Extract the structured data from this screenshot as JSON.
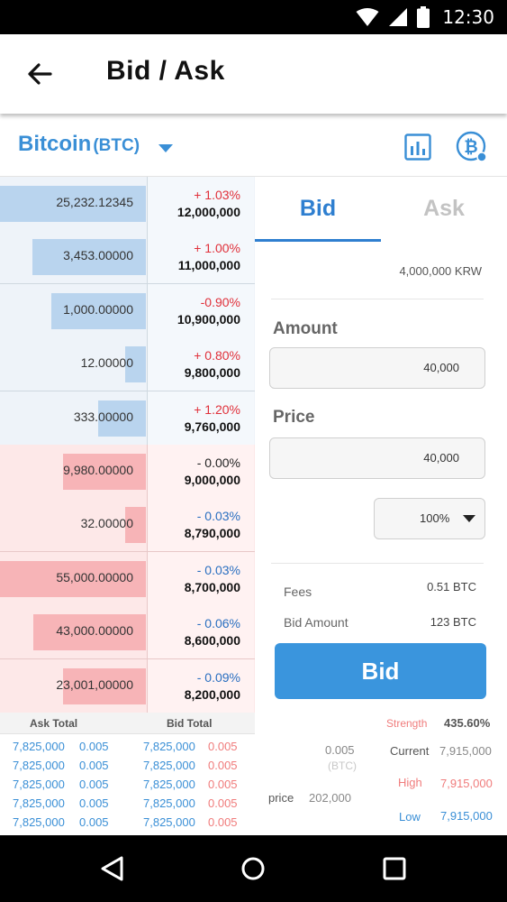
{
  "status_bar": {
    "time": "12:30"
  },
  "header": {
    "title": "Bid / Ask",
    "back_icon": "arrow-left-icon"
  },
  "coin": {
    "name": "Bitcoin",
    "code": "(BTC)"
  },
  "orderbook": {
    "ask_rows": [
      {
        "quantity": "25,232.12345",
        "change": "+ 1.03%",
        "price": "12,000,000",
        "direction": "up",
        "depth": 1.0
      },
      {
        "quantity": "3,453.00000",
        "change": "+ 1.00%",
        "price": "11,000,000",
        "direction": "up",
        "depth": 0.78
      },
      {
        "quantity": "1,000.00000",
        "change": "-0.90%",
        "price": "10,900,000",
        "direction": "up",
        "depth": 0.65
      },
      {
        "quantity": "12.00000",
        "change": "+ 0.80%",
        "price": "9,800,000",
        "direction": "up",
        "depth": 0.14
      },
      {
        "quantity": "333.00000",
        "change": "+ 1.20%",
        "price": "9,760,000",
        "direction": "up",
        "depth": 0.33
      }
    ],
    "bid_rows": [
      {
        "quantity": "9,980.00000",
        "change": "- 0.00%",
        "price": "9,000,000",
        "direction": "neutral",
        "depth": 0.57
      },
      {
        "quantity": "32.00000",
        "change": "- 0.03%",
        "price": "8,790,000",
        "direction": "down",
        "depth": 0.14
      },
      {
        "quantity": "55,000.00000",
        "change": "- 0.03%",
        "price": "8,700,000",
        "direction": "down",
        "depth": 1.0
      },
      {
        "quantity": "43,000.00000",
        "change": "- 0.06%",
        "price": "8,600,000",
        "direction": "down",
        "depth": 0.77
      },
      {
        "quantity": "23,001,00000",
        "change": "- 0.09%",
        "price": "8,200,000",
        "direction": "down",
        "depth": 0.57
      }
    ]
  },
  "trade": {
    "tabs": {
      "bid": "Bid",
      "ask": "Ask"
    },
    "balance": "4,000,000 KRW",
    "amount_label": "Amount",
    "amount_value": "40,000",
    "price_label": "Price",
    "price_value": "40,000",
    "percent_value": "100%",
    "fees_label": "Fees",
    "fees_value": "0.51 BTC",
    "bid_amount_label": "Bid Amount",
    "bid_amount_value": "123 BTC",
    "submit_label": "Bid"
  },
  "summary": {
    "ask_total_label": "Ask Total",
    "bid_total_label": "Bid Total",
    "rows": [
      {
        "ask_price": "7,825,000",
        "ask_qty": "0.005",
        "bid_price": "7,825,000",
        "bid_qty": "0.005"
      },
      {
        "ask_price": "7,825,000",
        "ask_qty": "0.005",
        "bid_price": "7,825,000",
        "bid_qty": "0.005"
      },
      {
        "ask_price": "7,825,000",
        "ask_qty": "0.005",
        "bid_price": "7,825,000",
        "bid_qty": "0.005"
      },
      {
        "ask_price": "7,825,000",
        "ask_qty": "0.005",
        "bid_price": "7,825,000",
        "bid_qty": "0.005"
      },
      {
        "ask_price": "7,825,000",
        "ask_qty": "0.005",
        "bid_price": "7,825,000",
        "bid_qty": "0.005"
      }
    ],
    "volume_value": "0.005",
    "volume_unit": "(BTC)",
    "price_label": "price",
    "price_value": "202,000",
    "strength_label": "Strength",
    "strength_value": "435.60%",
    "current_label": "Current",
    "current_value": "7,915,000",
    "high_label": "High",
    "high_value": "7,915,000",
    "low_label": "Low",
    "low_value": "7,915,000"
  },
  "colors": {
    "accent_blue": "#3a8fd6",
    "ask_bar": "#b9d4ee",
    "bid_bar": "#f7b4b7",
    "up_red": "#e0303a",
    "down_blue": "#2a6fc0",
    "submit_button": "#3a95dd"
  },
  "icons": {
    "status": [
      "wifi-icon",
      "signal-icon",
      "battery-icon"
    ],
    "chart": "bar-chart-icon",
    "coin": "bitcoin-icon",
    "nav": [
      "nav-back-icon",
      "nav-home-icon",
      "nav-recents-icon"
    ]
  }
}
